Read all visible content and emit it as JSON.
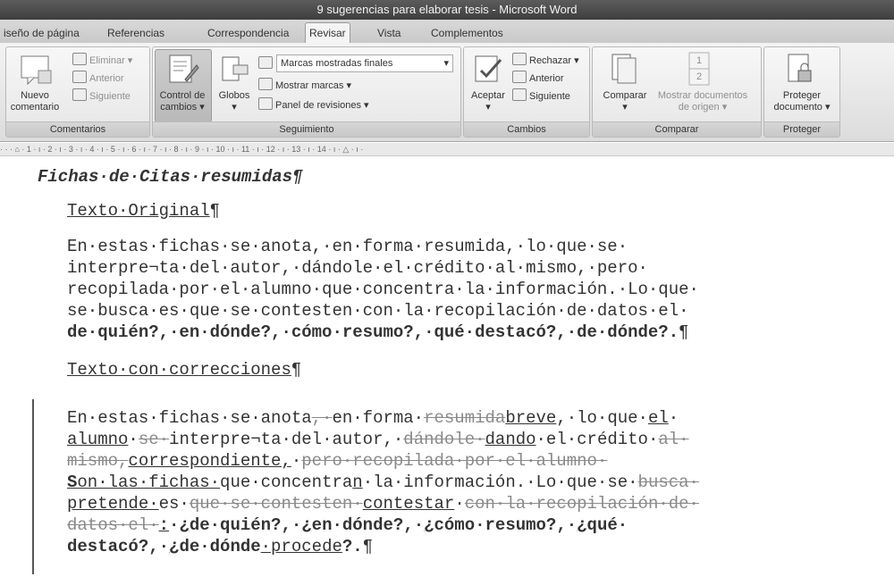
{
  "window": {
    "title": "9 sugerencias para elaborar tesis - Microsoft Word"
  },
  "tabs": [
    {
      "label": "iseño de página"
    },
    {
      "label": "Referencias"
    },
    {
      "label": "Correspondencia"
    },
    {
      "label": "Revisar"
    },
    {
      "label": "Vista"
    },
    {
      "label": "Complementos"
    }
  ],
  "ribbon": {
    "comentarios": {
      "label": "Comentarios",
      "nuevo_line1": "Nuevo",
      "nuevo_line2": "comentario",
      "eliminar": "Eliminar ▾",
      "anterior": "Anterior",
      "siguiente": "Siguiente"
    },
    "seguimiento": {
      "label": "Seguimiento",
      "control_line1": "Control de",
      "control_line2": "cambios ▾",
      "globos_line1": "Globos",
      "globos_line2": "▾",
      "marcas_select": "Marcas mostradas finales",
      "mostrar_marcas": "Mostrar marcas ▾",
      "panel": "Panel de revisiones ▾"
    },
    "cambios": {
      "label": "Cambios",
      "aceptar": "Aceptar",
      "aceptar_arrow": "▾",
      "rechazar": "Rechazar ▾",
      "anterior": "Anterior",
      "siguiente": "Siguiente"
    },
    "comparar": {
      "label": "Comparar",
      "comparar": "Comparar",
      "comparar_arrow": "▾",
      "mostrar_line1": "Mostrar documentos",
      "mostrar_line2": "de origen ▾",
      "doc_num1": "1",
      "doc_num2": "2"
    },
    "proteger": {
      "label": "Proteger",
      "proteger_line1": "Proteger",
      "proteger_line2": "documento ▾"
    }
  },
  "ruler": {
    "text": "· · · ⌂ · 1 · ı · 2 · ı · 3 · ı · 4 · ı · 5 · ı · 6 · ı · 7 · ı · 8 · ı · 9 · ı · 10 · ı · 11 · ı · 12 · ı · 13 · ı · 14 · ı · △ · ı ·"
  },
  "document": {
    "heading": "Fichas·de·Citas·resumidas¶",
    "section1_title": "Texto·Original",
    "section1_pilcrow": "¶",
    "original_lines": [
      "En·estas·fichas·se·anota,·en·forma·resumida,·lo·que·se·",
      "interpre¬ta·del·autor,·dándole·el·crédito·al·mismo,·pero·",
      "recopilada·por·el·alumno·que·concentra·la·información.·Lo·que·",
      "se·busca·es·que·se·contesten·con·la·recopilación·de·datos·el·"
    ],
    "original_last_bold": "de·quién?,·en·dónde?,·cómo·resumo?,·qué·destacó?,·de·dónde?.",
    "original_last_pilcrow": "¶",
    "section2_title": "Texto·con·correcciones",
    "section2_pilcrow": "¶",
    "corr": {
      "l1_a": "En·estas·fichas·se·anota",
      "l1_del1": ",·",
      "l1_b": "en·forma·",
      "l1_del2": "resumida",
      "l1_ins1": "breve",
      "l1_c": ",·lo·que·",
      "l1_ins2": "el",
      "l1_d": "·",
      "l2_ins1": "alumno",
      "l2_a": "·",
      "l2_del1": "se·",
      "l2_b": "interpre¬ta·del·autor,·",
      "l2_del2": "dándole·",
      "l2_ins2": "dando",
      "l2_c": "·el·crédito·",
      "l2_del3": "al·",
      "l3_del1": "mismo,",
      "l3_ins1": "correspondiente,",
      "l3_a": "·",
      "l3_del2": "pero·recopilada·por·el·alumno·",
      "l4_ins1": "S",
      "l4_a": "on·las·fichas·",
      "l4_b": "que·concentra",
      "l4_ins2": "n",
      "l4_c": "·la·información.·Lo·que·se·",
      "l4_del1": "busca·",
      "l5_ins1": "pretende·",
      "l5_a": "es·",
      "l5_del1": "que·se·contesten·",
      "l5_ins2": "contestar",
      "l5_b": "·",
      "l5_del2": "con·la·recopilación·de·",
      "l6_del1": "datos·el·",
      "l6_ins1": ":",
      "l6_a": "·",
      "l6_ins2": "¿",
      "l6_b": "de·quién?,·",
      "l6_ins3": "¿",
      "l6_c": "en·dónde?,·",
      "l6_ins4": "¿",
      "l6_d": "cómo·resumo?,·",
      "l6_ins5": "¿",
      "l6_e": "qué·",
      "l7_a": "destacó?,·",
      "l7_ins1": "¿",
      "l7_b": "de·dónde",
      "l7_ins2": "·procede",
      "l7_c": "?.",
      "l7_pilcrow": "¶"
    }
  }
}
